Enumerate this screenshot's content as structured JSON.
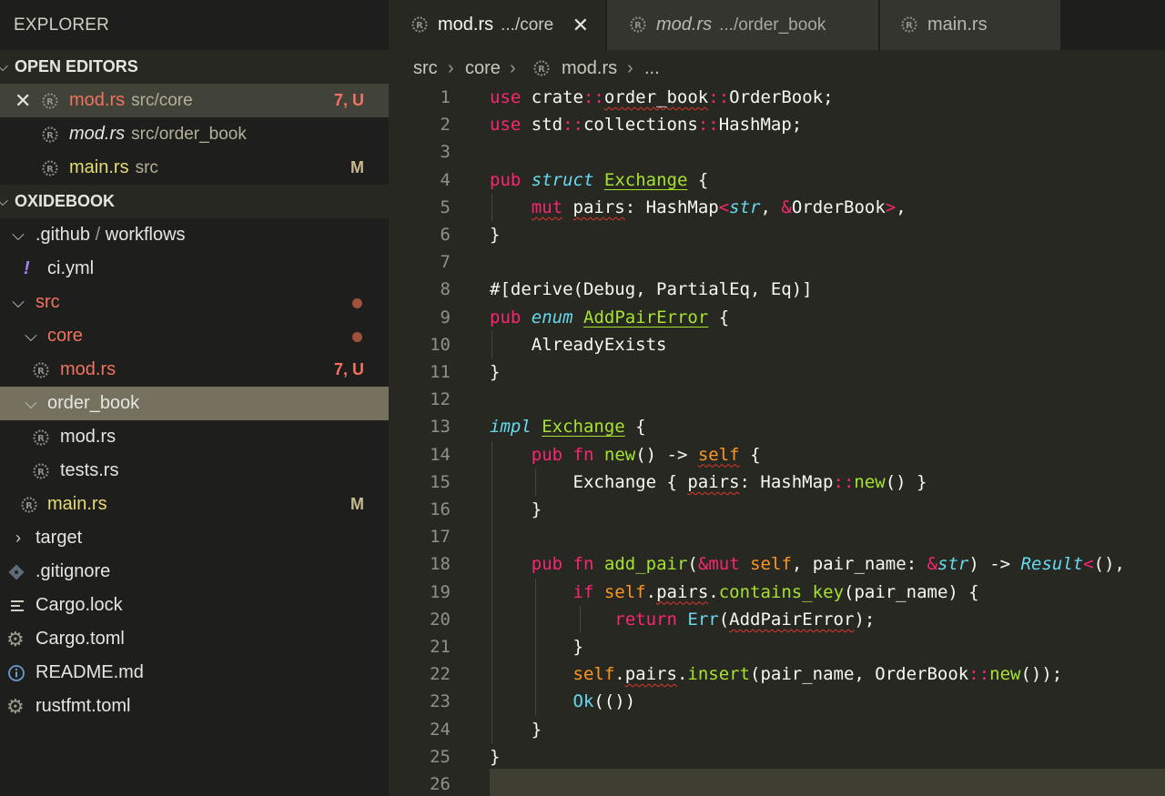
{
  "explorer": {
    "title": "EXPLORER",
    "open_editors": {
      "label": "OPEN EDITORS",
      "items": [
        {
          "name": "mod.rs",
          "path": "src/core",
          "badge": "7, U"
        },
        {
          "name": "mod.rs",
          "path": "src/order_book",
          "badge": ""
        },
        {
          "name": "main.rs",
          "path": "src",
          "badge": "M"
        }
      ]
    },
    "project": {
      "label": "OXIDEBOOK",
      "items": [
        {
          "name": ".github",
          "sep": "/",
          "sub": "workflows"
        },
        {
          "name": "ci.yml"
        },
        {
          "name": "src"
        },
        {
          "name": "core"
        },
        {
          "name": "mod.rs",
          "badge": "7, U"
        },
        {
          "name": "order_book"
        },
        {
          "name": "mod.rs"
        },
        {
          "name": "tests.rs"
        },
        {
          "name": "main.rs",
          "badge": "M"
        },
        {
          "name": "target"
        },
        {
          "name": ".gitignore"
        },
        {
          "name": "Cargo.lock"
        },
        {
          "name": "Cargo.toml"
        },
        {
          "name": "README.md"
        },
        {
          "name": "rustfmt.toml"
        }
      ]
    }
  },
  "tabs": [
    {
      "name": "mod.rs",
      "desc": ".../core",
      "active": true
    },
    {
      "name": "mod.rs",
      "desc": ".../order_book",
      "active": false
    },
    {
      "name": "main.rs",
      "desc": "",
      "active": false
    }
  ],
  "breadcrumb": [
    "src",
    "core",
    "mod.rs",
    "..."
  ],
  "icons": {
    "rust": "rust-file-icon",
    "yaml": "yaml-file-icon",
    "git": "git-file-icon",
    "lock": "lines-file-icon",
    "gear": "gear-icon",
    "info": "info-icon"
  },
  "colors": {
    "modified_red": "#f0725f",
    "git_modified": "#e6db74",
    "keyword": "#f92672",
    "storage": "#66d9ef",
    "function": "#a6e22e",
    "self": "#fd971f"
  },
  "editor": {
    "language": "rust",
    "lines": [
      "use crate::order_book::OrderBook;",
      "use std::collections::HashMap;",
      "",
      "pub struct Exchange {",
      "    mut pairs: HashMap<str, &OrderBook>,",
      "}",
      "",
      "#[derive(Debug, PartialEq, Eq)]",
      "pub enum AddPairError {",
      "    AlreadyExists",
      "}",
      "",
      "impl Exchange {",
      "    pub fn new() -> self {",
      "        Exchange { pairs: HashMap::new() }",
      "    }",
      "",
      "    pub fn add_pair(&mut self, pair_name: &str) -> Result<(),",
      "        if self.pairs.contains_key(pair_name) {",
      "            return Err(AddPairError);",
      "        }",
      "        self.pairs.insert(pair_name, OrderBook::new());",
      "        Ok(())",
      "    }",
      "}",
      ""
    ]
  }
}
